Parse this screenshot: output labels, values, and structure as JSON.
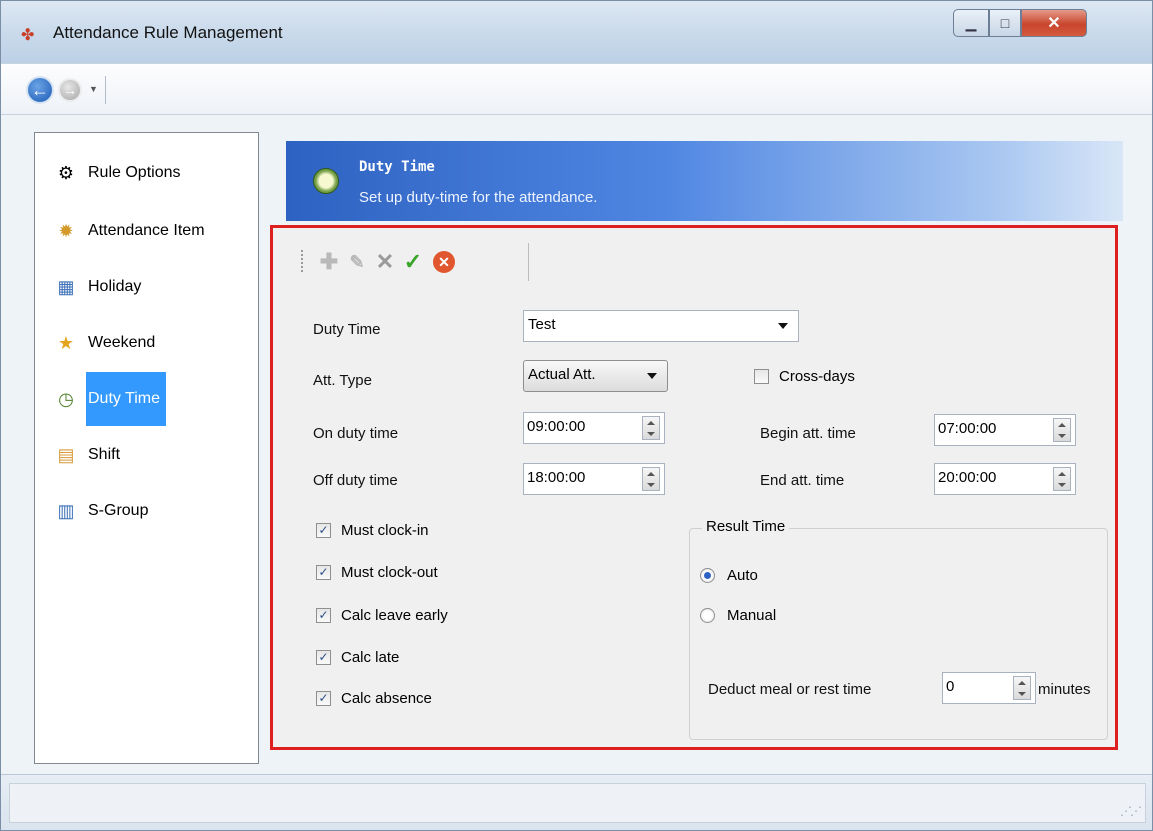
{
  "window": {
    "title": "Attendance Rule Management"
  },
  "sidebar": {
    "items": [
      {
        "label": "Rule Options",
        "icon": "rule-options-icon"
      },
      {
        "label": "Attendance Item",
        "icon": "gear-icon"
      },
      {
        "label": "Holiday",
        "icon": "calendar-icon"
      },
      {
        "label": "Weekend",
        "icon": "weekend-star-icon"
      },
      {
        "label": "Duty Time",
        "icon": "clock-icon",
        "active": true
      },
      {
        "label": "Shift",
        "icon": "shift-grid-icon"
      },
      {
        "label": "S-Group",
        "icon": "group-grid-icon"
      }
    ]
  },
  "banner": {
    "title": "Duty Time",
    "subtitle": "Set up duty-time for the attendance."
  },
  "form": {
    "duty_time_label": "Duty Time",
    "duty_time_value": "Test",
    "att_type_label": "Att. Type",
    "att_type_value": "Actual Att.",
    "cross_days_label": "Cross-days",
    "cross_days_checked": false,
    "on_duty_label": "On duty time",
    "on_duty_value": "09:00:00",
    "off_duty_label": "Off duty time",
    "off_duty_value": "18:00:00",
    "begin_att_label": "Begin att. time",
    "begin_att_value": "07:00:00",
    "end_att_label": "End att. time",
    "end_att_value": "20:00:00",
    "checks": [
      {
        "label": "Must clock-in",
        "checked": true
      },
      {
        "label": "Must clock-out",
        "checked": true
      },
      {
        "label": "Calc leave early",
        "checked": true
      },
      {
        "label": "Calc late",
        "checked": true
      },
      {
        "label": "Calc absence",
        "checked": true
      }
    ],
    "result_time": {
      "title": "Result Time",
      "auto_label": "Auto",
      "manual_label": "Manual",
      "selected": "Auto",
      "deduct_label": "Deduct meal or rest time",
      "deduct_value": "0",
      "unit": "minutes"
    }
  },
  "colors": {
    "highlight": "#dd1f1f",
    "accent": "#3399ff"
  }
}
